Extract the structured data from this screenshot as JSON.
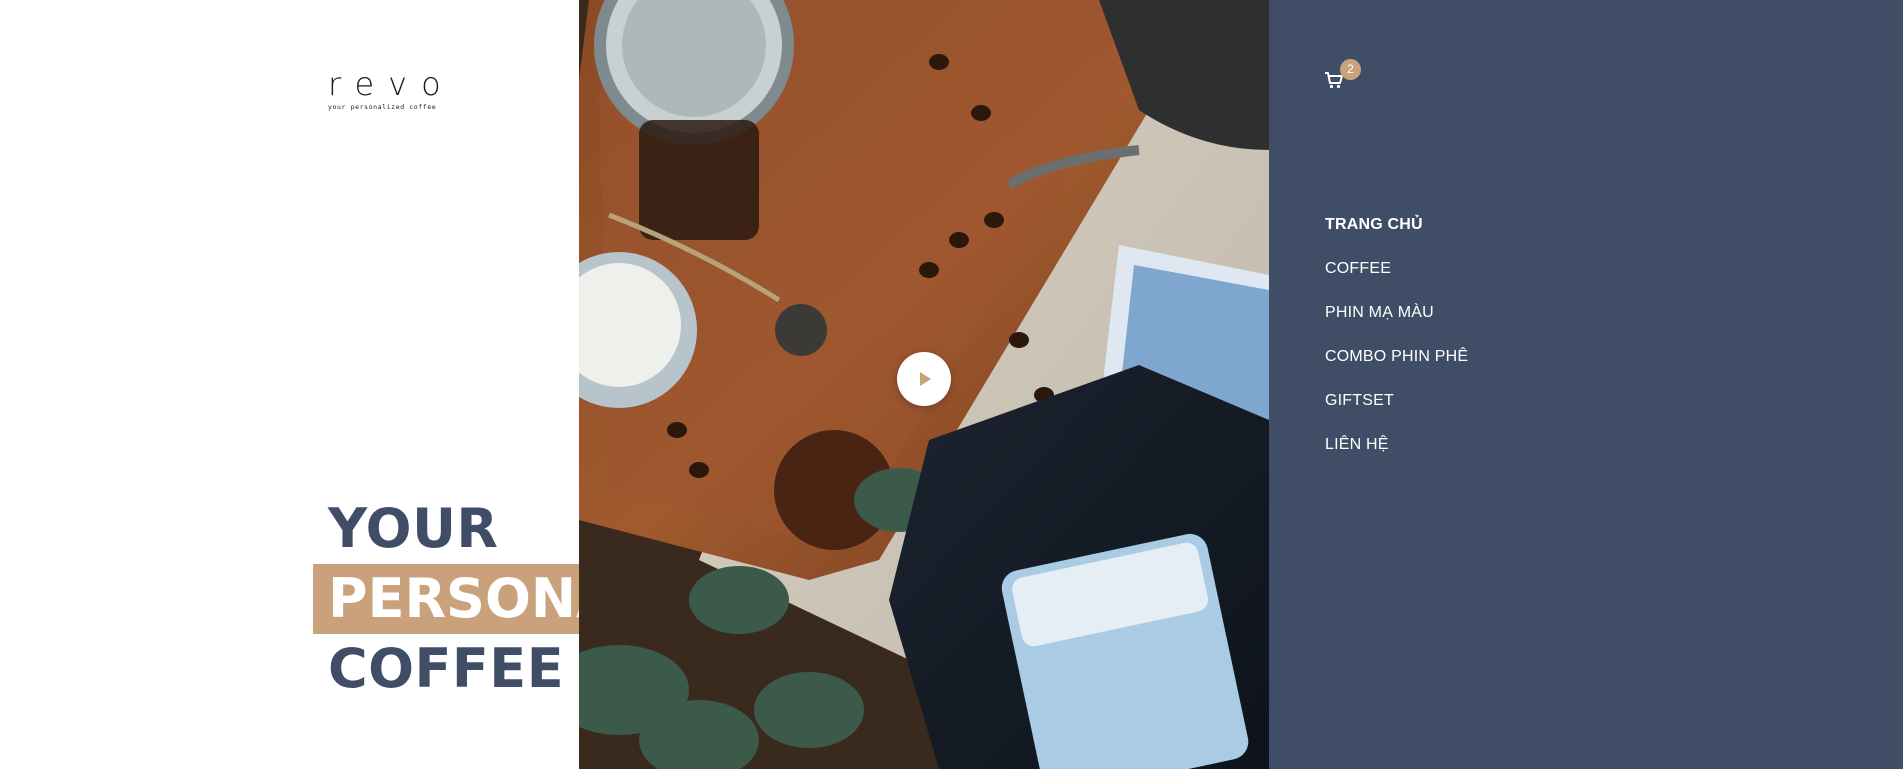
{
  "logo": {
    "wordmark": "revo",
    "tagline": "your personalized coffee"
  },
  "headline": {
    "line1": "YOUR",
    "line2": "PERSONALIZED",
    "line3": "COFFEE"
  },
  "cart": {
    "icon": "cart-icon",
    "count": "2"
  },
  "nav": {
    "items": [
      {
        "label": "TRANG CHỦ",
        "active": true
      },
      {
        "label": "COFFEE"
      },
      {
        "label": "PHIN MẠ MÀU"
      },
      {
        "label": "COMBO PHIN PHÊ"
      },
      {
        "label": "GIFTSET"
      },
      {
        "label": "LIÊN HỆ"
      }
    ]
  },
  "video": {
    "icon": "play-icon"
  },
  "colors": {
    "navy": "#3f4e66",
    "accent": "#c9a27c",
    "white": "#ffffff"
  }
}
